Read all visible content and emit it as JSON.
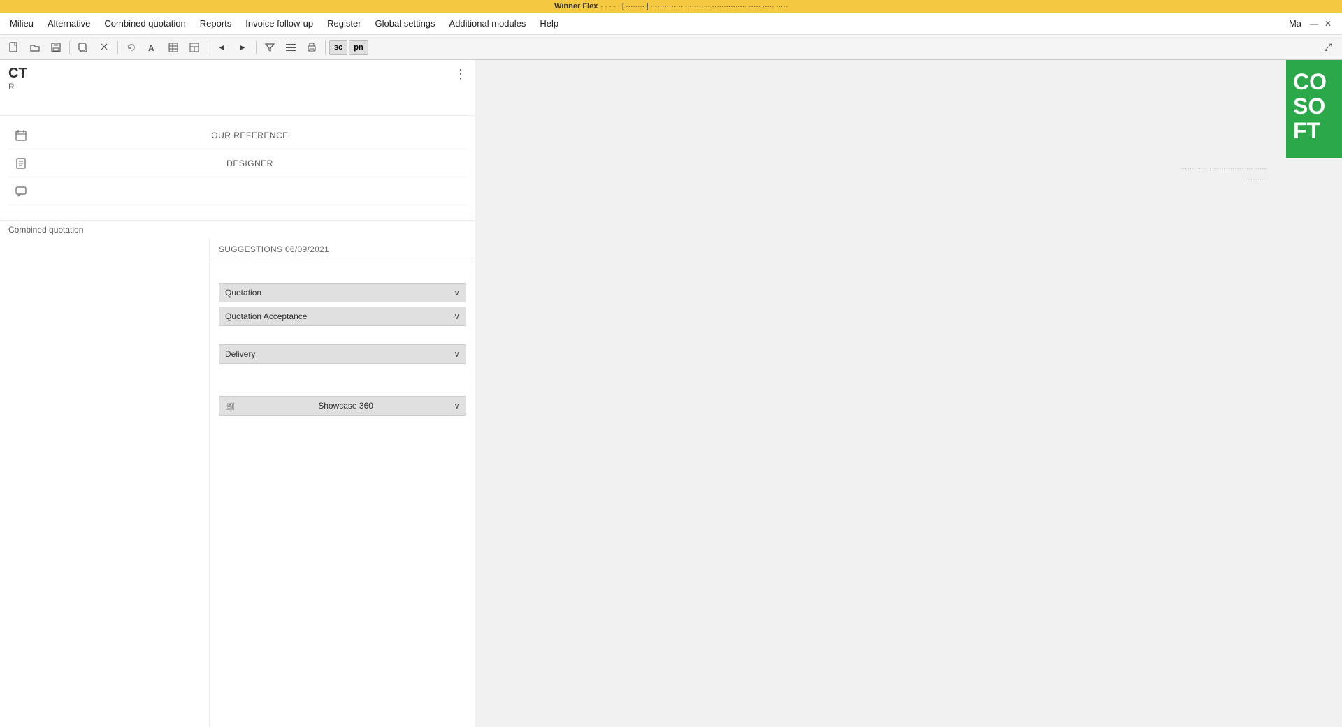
{
  "titlebar": {
    "app": "Winner Flex",
    "extra": "· · · · · [ ········ ] ·············· ········ ·· ···············  ·····  ·····  ·····"
  },
  "menubar": {
    "items": [
      {
        "id": "milieu",
        "label": "Milieu"
      },
      {
        "id": "alternative",
        "label": "Alternative"
      },
      {
        "id": "combined-quotation",
        "label": "Combined quotation"
      },
      {
        "id": "reports",
        "label": "Reports"
      },
      {
        "id": "invoice-followup",
        "label": "Invoice follow-up"
      },
      {
        "id": "register",
        "label": "Register"
      },
      {
        "id": "global-settings",
        "label": "Global settings"
      },
      {
        "id": "additional-modules",
        "label": "Additional modules"
      },
      {
        "id": "help",
        "label": "Help"
      },
      {
        "id": "ma",
        "label": "Ma"
      }
    ]
  },
  "toolbar": {
    "buttons": [
      {
        "id": "new",
        "icon": "📄"
      },
      {
        "id": "open",
        "icon": "📂"
      },
      {
        "id": "save",
        "icon": "💾"
      },
      {
        "id": "copy",
        "icon": "⊡"
      },
      {
        "id": "cut",
        "icon": "✂"
      },
      {
        "id": "undo",
        "icon": "↩"
      },
      {
        "id": "font",
        "icon": "A"
      },
      {
        "id": "table",
        "icon": "▦"
      },
      {
        "id": "layout",
        "icon": "◫"
      },
      {
        "id": "arrow-left",
        "icon": "◂"
      },
      {
        "id": "arrow-right",
        "icon": "▸"
      },
      {
        "id": "print",
        "icon": "🖨"
      },
      {
        "id": "sc",
        "special": true,
        "label": "sc"
      },
      {
        "id": "pn",
        "special": true,
        "label": "pn"
      }
    ]
  },
  "ct": {
    "title": "CT",
    "subtitle": "R",
    "three_dots": "⋮"
  },
  "fields": [
    {
      "id": "calendar",
      "icon": "📅",
      "label": "OUR REFERENCE"
    },
    {
      "id": "document",
      "icon": "📋",
      "label": "DESIGNER"
    },
    {
      "id": "message",
      "icon": "💬",
      "label": ""
    }
  ],
  "combined_quotation": {
    "label": "Combined quotation"
  },
  "suggestions": {
    "header": "SUGGESTIONS 06/09/2021",
    "dropdowns": [
      {
        "id": "quotation",
        "label": "Quotation",
        "icon": null,
        "has_icon": false
      },
      {
        "id": "quotation-acceptance",
        "label": "Quotation Acceptance",
        "icon": null,
        "has_icon": false
      },
      {
        "id": "delivery",
        "label": "Delivery",
        "icon": null,
        "has_icon": false
      },
      {
        "id": "showcase-360",
        "label": "Showcase 360",
        "icon": "🖼",
        "has_icon": true
      }
    ]
  },
  "logo": {
    "lines": [
      "CO",
      "SO",
      "FT"
    ]
  },
  "info_panel": {
    "line1": "······ ···· ········ ·······  ···  ·····",
    "line2": "·········"
  },
  "chevron": "∨"
}
